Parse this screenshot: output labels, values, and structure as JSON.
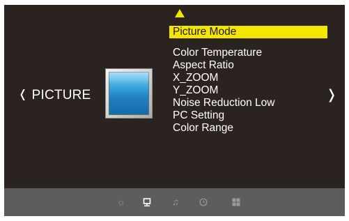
{
  "category": {
    "label": "PICTURE",
    "prev_glyph": "❬",
    "next_glyph": "❭"
  },
  "menu": {
    "up_arrow_icon": "triangle-up-icon",
    "items": [
      {
        "label": "Picture Mode",
        "selected": true
      },
      {
        "label": "Color Temperature"
      },
      {
        "label": "Aspect Ratio"
      },
      {
        "label": "X_ZOOM"
      },
      {
        "label": "Y_ZOOM"
      },
      {
        "label": "Noise Reduction Low"
      },
      {
        "label": "PC Setting"
      },
      {
        "label": "Color Range"
      }
    ]
  },
  "bottom_tabs": [
    {
      "icon": "sun-icon",
      "glyph": "☼",
      "active": false
    },
    {
      "icon": "monitor-icon",
      "glyph": "",
      "active": true
    },
    {
      "icon": "music-note-icon",
      "glyph": "♫",
      "active": false
    },
    {
      "icon": "clock-icon",
      "glyph": "",
      "active": false
    },
    {
      "icon": "grid-icon",
      "glyph": "",
      "active": false
    }
  ],
  "colors": {
    "background": "#2b2320",
    "highlight": "#f5e600",
    "bottom_bar": "#5f5d5b",
    "text": "#ffffff"
  }
}
